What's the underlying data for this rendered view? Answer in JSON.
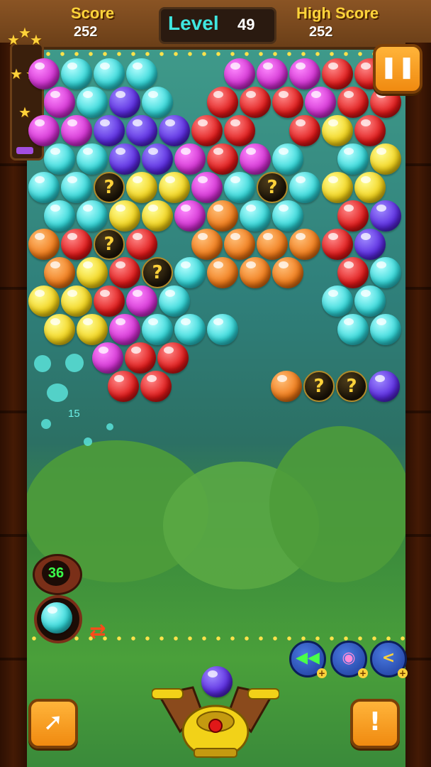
{
  "hud": {
    "score_label": "Score",
    "score_value": "252",
    "level_label": "Level",
    "level_value": "49",
    "high_score_label": "High Score",
    "high_score_value": "252"
  },
  "game": {
    "shots_remaining": "36",
    "floating_points": "15",
    "current_bubble_color": "purple",
    "next_bubble_color": "cyan",
    "mystery_mark": "?",
    "colors": {
      "magenta": "#d030d0",
      "cyan": "#30d6d8",
      "purple": "#5a2ae0",
      "red": "#e01818",
      "yellow": "#f2d218",
      "orange": "#f07a18"
    }
  },
  "controls": {
    "pause_icon": "pause-icon",
    "share_icon": "share-arrow-icon",
    "hint_icon": "exclamation-icon",
    "boosters": [
      {
        "name": "rewind-booster",
        "icon": "rewind-icon"
      },
      {
        "name": "bomb-booster",
        "icon": "bomb-icon"
      },
      {
        "name": "aim-booster",
        "icon": "aim-line-icon"
      }
    ]
  }
}
